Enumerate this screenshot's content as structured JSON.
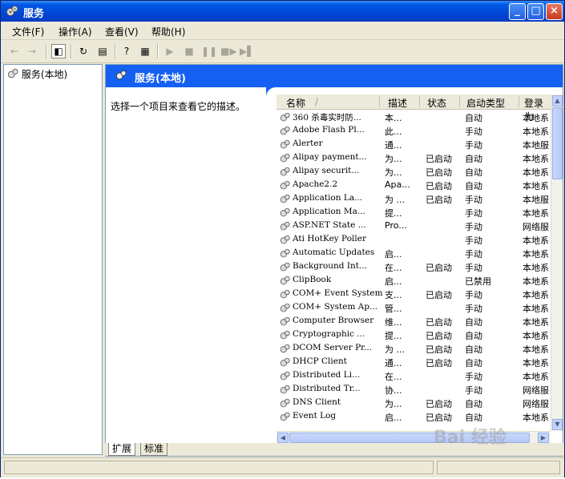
{
  "window": {
    "title": "服务"
  },
  "menu": [
    "文件(F)",
    "操作(A)",
    "查看(V)",
    "帮助(H)"
  ],
  "tree": {
    "root": "服务(本地)"
  },
  "pane": {
    "header": "服务(本地)",
    "description": "选择一个项目来查看它的描述。"
  },
  "columns": [
    "名称",
    "描述",
    "状态",
    "启动类型",
    "登录为"
  ],
  "services": [
    [
      "360 杀毒实时防...",
      "本...",
      "",
      "自动",
      "本地系"
    ],
    [
      "Adobe Flash Pl...",
      "此...",
      "",
      "手动",
      "本地系"
    ],
    [
      "Alerter",
      "通...",
      "",
      "手动",
      "本地服"
    ],
    [
      "Alipay payment...",
      "为...",
      "已启动",
      "自动",
      "本地系"
    ],
    [
      "Alipay securit...",
      "为...",
      "已启动",
      "自动",
      "本地系"
    ],
    [
      "Apache2.2",
      "Apa...",
      "已启动",
      "自动",
      "本地系"
    ],
    [
      "Application La...",
      "为 ...",
      "已启动",
      "手动",
      "本地服"
    ],
    [
      "Application Ma...",
      "提...",
      "",
      "手动",
      "本地系"
    ],
    [
      "ASP.NET State ...",
      "Pro...",
      "",
      "手动",
      "网络服"
    ],
    [
      "Ati HotKey Poller",
      "",
      "",
      "手动",
      "本地系"
    ],
    [
      "Automatic Updates",
      "启...",
      "",
      "手动",
      "本地系"
    ],
    [
      "Background Int...",
      "在...",
      "已启动",
      "手动",
      "本地系"
    ],
    [
      "ClipBook",
      "启...",
      "",
      "已禁用",
      "本地系"
    ],
    [
      "COM+ Event System",
      "支...",
      "已启动",
      "手动",
      "本地系"
    ],
    [
      "COM+ System Ap...",
      "管...",
      "",
      "手动",
      "本地系"
    ],
    [
      "Computer Browser",
      "维...",
      "已启动",
      "自动",
      "本地系"
    ],
    [
      "Cryptographic ...",
      "提...",
      "已启动",
      "自动",
      "本地系"
    ],
    [
      "DCOM Server Pr...",
      "为 ...",
      "已启动",
      "自动",
      "本地系"
    ],
    [
      "DHCP Client",
      "通...",
      "已启动",
      "自动",
      "本地系"
    ],
    [
      "Distributed Li...",
      "在...",
      "",
      "手动",
      "本地系"
    ],
    [
      "Distributed Tr...",
      "协...",
      "",
      "手动",
      "网络服"
    ],
    [
      "DNS Client",
      "为...",
      "已启动",
      "自动",
      "网络服"
    ],
    [
      "Event Log",
      "启...",
      "已启动",
      "自动",
      "本地系"
    ]
  ],
  "tabs": [
    "扩展",
    "标准"
  ],
  "watermark": "Bai 经验"
}
